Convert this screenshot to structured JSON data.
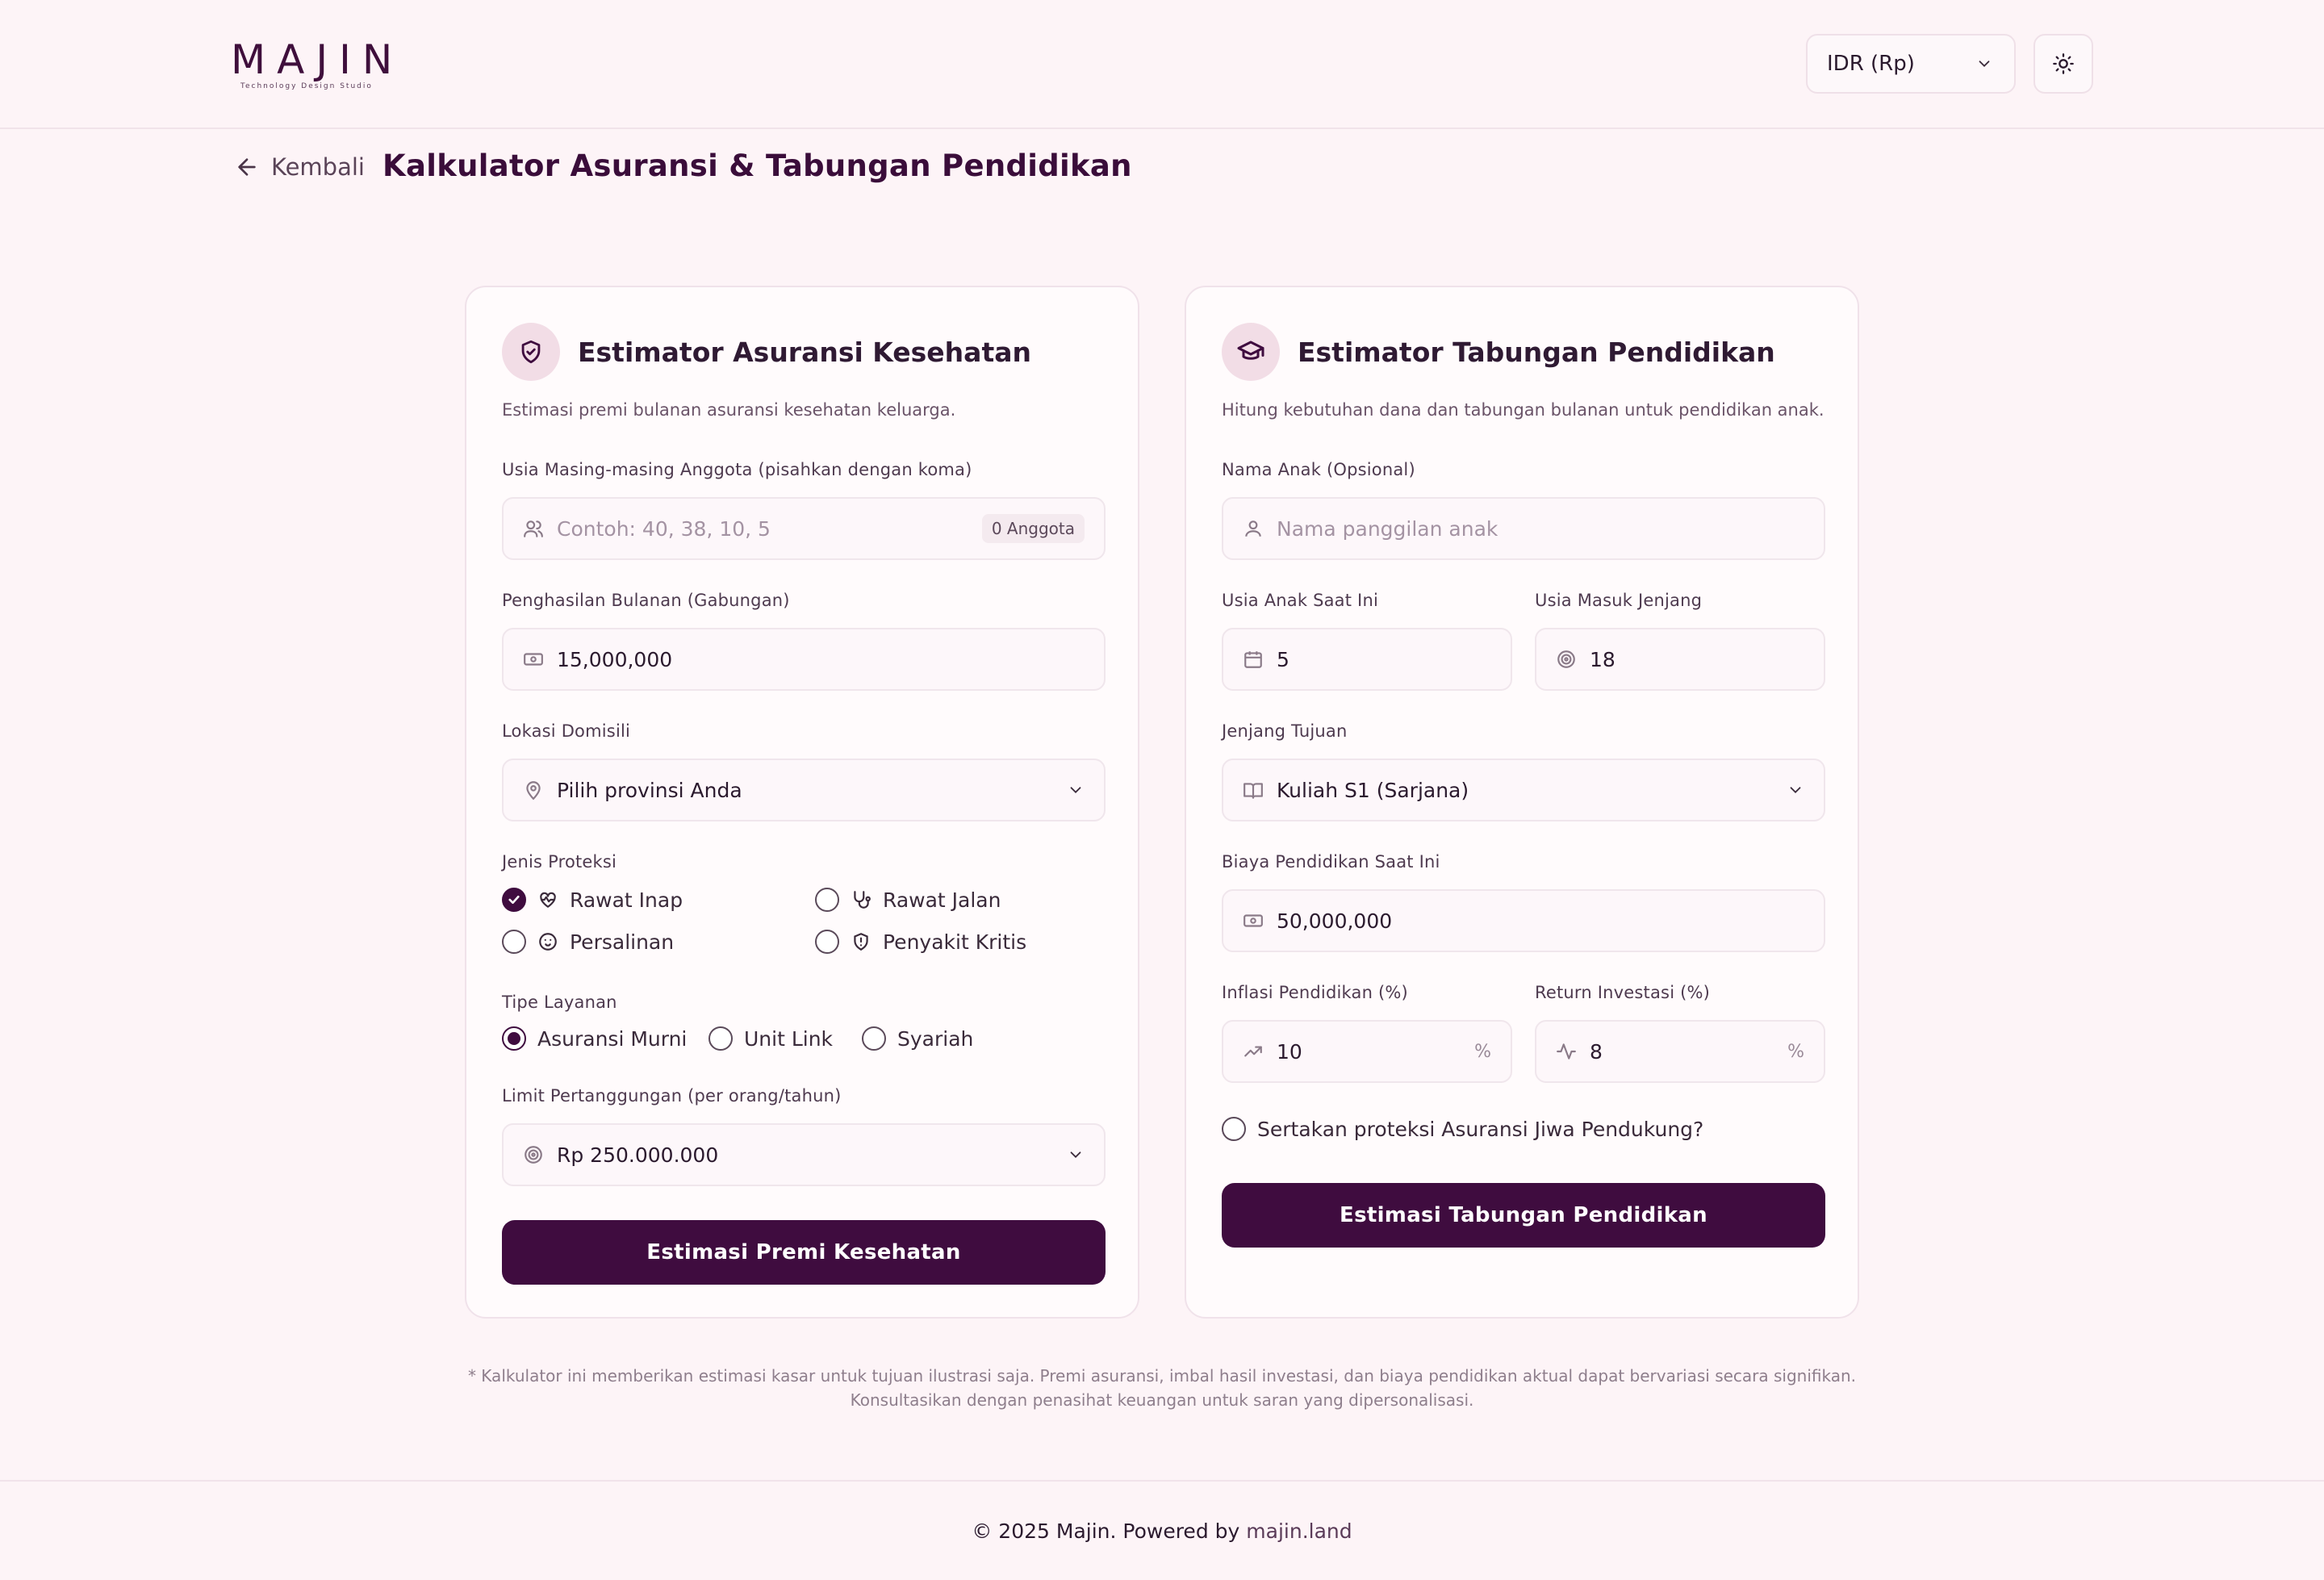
{
  "header": {
    "logo_text": "MAJIN",
    "logo_sub": "Technology Design Studio",
    "currency": "IDR (Rp)"
  },
  "nav": {
    "back_label": "Kembali",
    "page_title": "Kalkulator Asuransi & Tabungan Pendidikan"
  },
  "health": {
    "title": "Estimator Asuransi Kesehatan",
    "desc": "Estimasi premi bulanan asuransi kesehatan keluarga.",
    "ages_label": "Usia Masing-masing Anggota (pisahkan dengan koma)",
    "ages_placeholder": "Contoh: 40, 38, 10, 5",
    "ages_badge": "0 Anggota",
    "income_label": "Penghasilan Bulanan (Gabungan)",
    "income_value": "15,000,000",
    "location_label": "Lokasi Domisili",
    "location_value": "Pilih provinsi Anda",
    "protection_label": "Jenis Proteksi",
    "protections": [
      {
        "label": "Rawat Inap",
        "checked": true
      },
      {
        "label": "Rawat Jalan",
        "checked": false
      },
      {
        "label": "Persalinan",
        "checked": false
      },
      {
        "label": "Penyakit Kritis",
        "checked": false
      }
    ],
    "service_label": "Tipe Layanan",
    "services": [
      {
        "label": "Asuransi Murni",
        "selected": true
      },
      {
        "label": "Unit Link",
        "selected": false
      },
      {
        "label": "Syariah",
        "selected": false
      }
    ],
    "limit_label": "Limit Pertanggungan (per orang/tahun)",
    "limit_value": "Rp 250.000.000",
    "button": "Estimasi Premi Kesehatan"
  },
  "education": {
    "title": "Estimator Tabungan Pendidikan",
    "desc": "Hitung kebutuhan dana dan tabungan bulanan untuk pendidikan anak.",
    "name_label": "Nama Anak (Opsional)",
    "name_placeholder": "Nama panggilan anak",
    "age_label": "Usia Anak Saat Ini",
    "age_value": "5",
    "entry_label": "Usia Masuk Jenjang",
    "entry_value": "18",
    "level_label": "Jenjang Tujuan",
    "level_value": "Kuliah S1 (Sarjana)",
    "cost_label": "Biaya Pendidikan Saat Ini",
    "cost_value": "50,000,000",
    "inflation_label": "Inflasi Pendidikan (%)",
    "inflation_value": "10",
    "return_label": "Return Investasi (%)",
    "return_value": "8",
    "percent": "%",
    "insurance_toggle": "Sertakan proteksi Asuransi Jiwa Pendukung?",
    "button": "Estimasi Tabungan Pendidikan"
  },
  "disclaimer": {
    "line1": "* Kalkulator ini memberikan estimasi kasar untuk tujuan ilustrasi saja. Premi asuransi, imbal hasil investasi, dan biaya pendidikan aktual dapat bervariasi secara signifikan.",
    "line2": "Konsultasikan dengan penasihat keuangan untuk saran yang dipersonalisasi."
  },
  "footer": {
    "text": "© 2025 Majin. Powered by",
    "link": "majin.land"
  },
  "colors": {
    "primary": "#3f0c3f",
    "background": "#fdf4f7",
    "card": "#fffbfc"
  }
}
